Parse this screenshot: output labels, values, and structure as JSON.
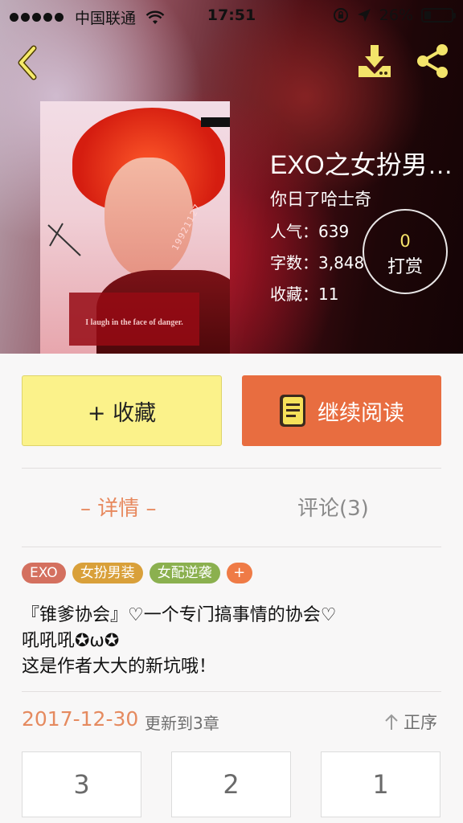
{
  "status_bar": {
    "carrier": "中国联通",
    "time": "17:51",
    "battery": "26%",
    "battery_level": 0.26
  },
  "nav": {
    "back_icon": "chevron-left-icon",
    "download_icon": "download-icon",
    "share_icon": "share-icon"
  },
  "cover": {
    "code": "19921127",
    "caption": "I laugh in the face of danger."
  },
  "book": {
    "title": "EXO之女扮男…",
    "author": "你日了哈士奇",
    "popularity": "人气：639",
    "word_count": "字数：3,848",
    "favorites": "收藏：11"
  },
  "reward": {
    "count": "0",
    "label": "打赏"
  },
  "actions": {
    "collect": "+ 收藏",
    "continue_reading": "继续阅读"
  },
  "tabs": {
    "detail": "– 详情 –",
    "comments": "评论(3)"
  },
  "tags": [
    {
      "label": "EXO",
      "color": "#d4705f"
    },
    {
      "label": "女扮男装",
      "color": "#d9a03a"
    },
    {
      "label": "女配逆袭",
      "color": "#8bb04f"
    },
    {
      "label": "+",
      "color": "#ef7b46"
    }
  ],
  "description": {
    "line1": "『锥爹协会』♡一个专门搞事情的协会♡",
    "line2": "吼吼吼✪ω✪",
    "line3": "这是作者大大的新坑哦！"
  },
  "update": {
    "date": "2017-12-30",
    "text": "更新到3章",
    "sort": "正序"
  },
  "chapters": [
    "3",
    "2",
    "1"
  ],
  "colors": {
    "accent_orange": "#e86d40",
    "collect_yellow": "#fbf28a",
    "date_orange": "#e58a5f"
  }
}
